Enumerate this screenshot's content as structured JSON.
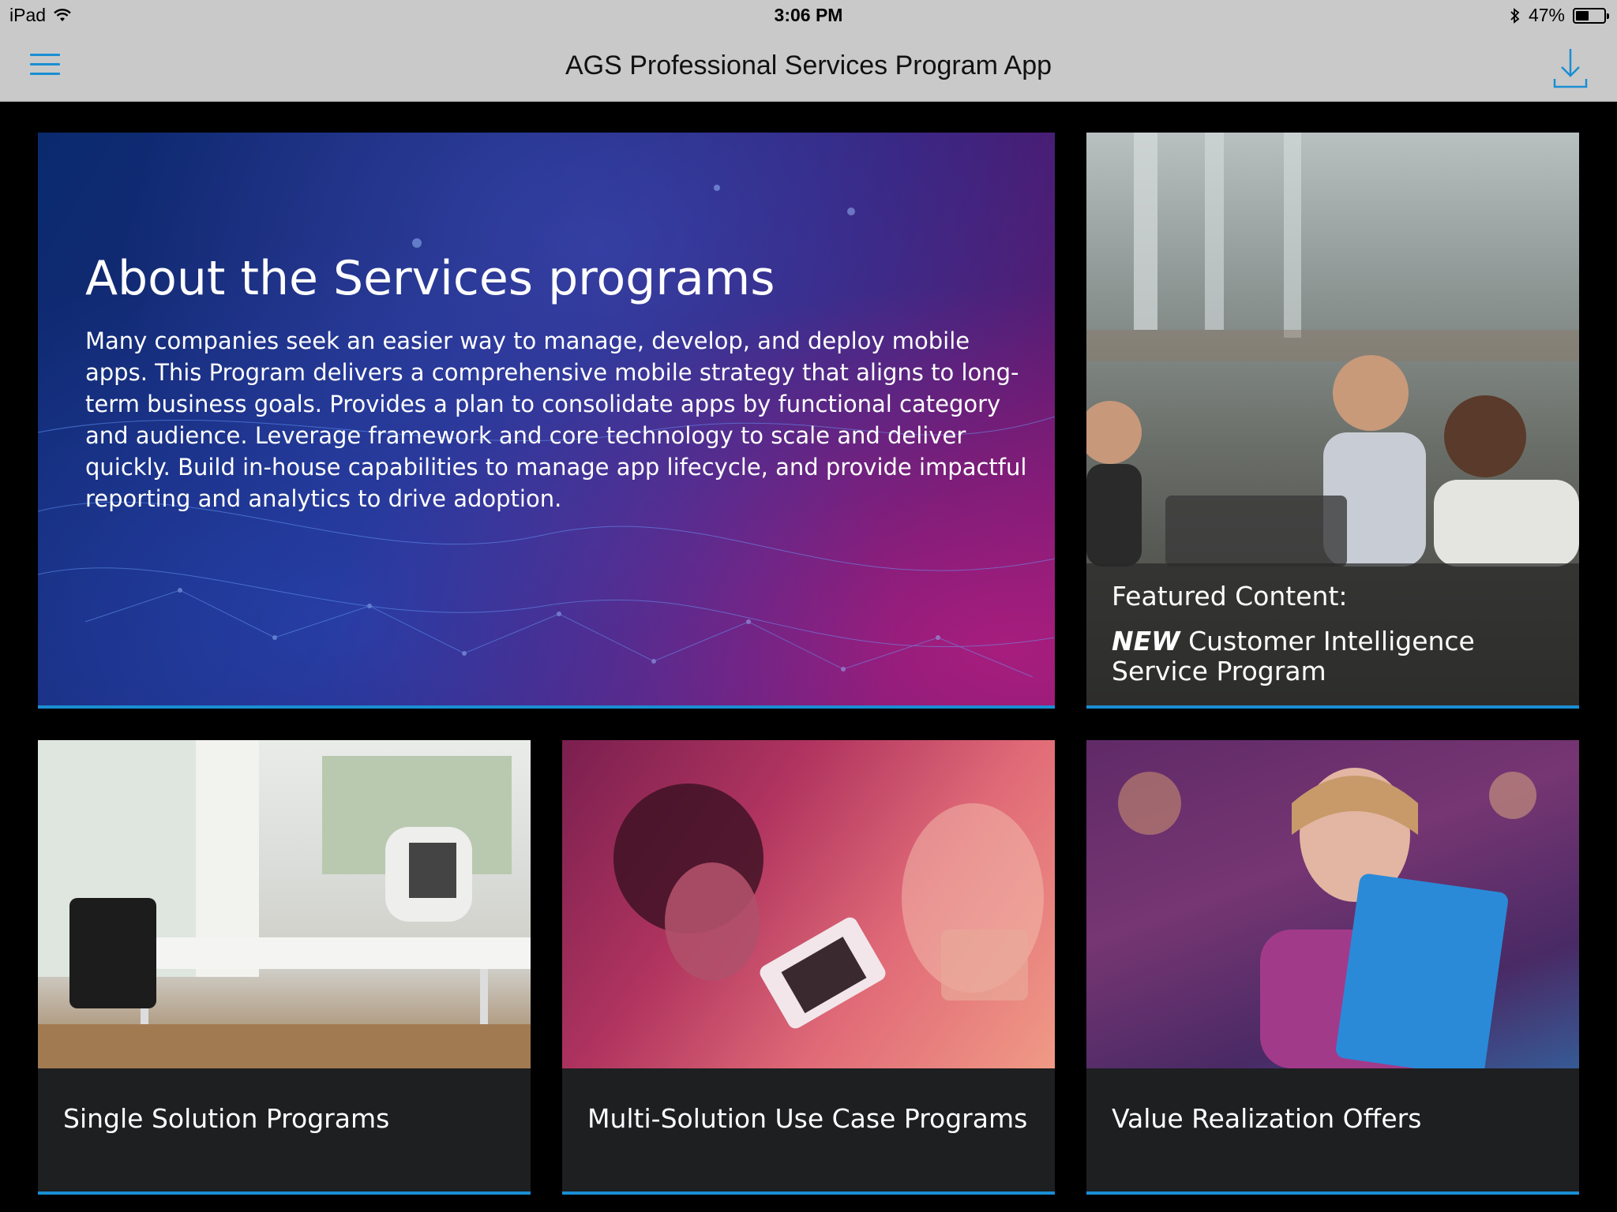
{
  "status_bar": {
    "device": "iPad",
    "time": "3:06 PM",
    "battery": "47%",
    "battery_level": 0.47,
    "icons": [
      "wifi-icon",
      "bluetooth-icon",
      "battery-icon"
    ]
  },
  "nav": {
    "title": "AGS Professional Services Program App",
    "menu_icon": "hamburger-menu-icon",
    "download_icon": "download-icon"
  },
  "hero": {
    "title": "About the Services programs",
    "body": "Many companies seek an easier way to manage, develop, and deploy mobile apps. This Program delivers a comprehensive mobile strategy that aligns to long-term business goals. Provides a plan to consolidate apps by functional category and audience. Leverage framework and core technology to scale and deliver quickly. Build in-house capabilities to manage app lifecycle, and provide impactful reporting and analytics to drive adoption."
  },
  "featured": {
    "label": "Featured Content:",
    "new_tag": "NEW",
    "title": "Customer Intelligence Service Program"
  },
  "tiles": [
    {
      "label": "Single Solution Programs"
    },
    {
      "label": "Multi-Solution Use Case Programs"
    },
    {
      "label": "Value Realization Offers"
    }
  ],
  "colors": {
    "accent": "#1a8ed3",
    "nav_background": "#c9c9c9",
    "tile_caption_background": "#1e1f21",
    "page_background": "#000000"
  }
}
